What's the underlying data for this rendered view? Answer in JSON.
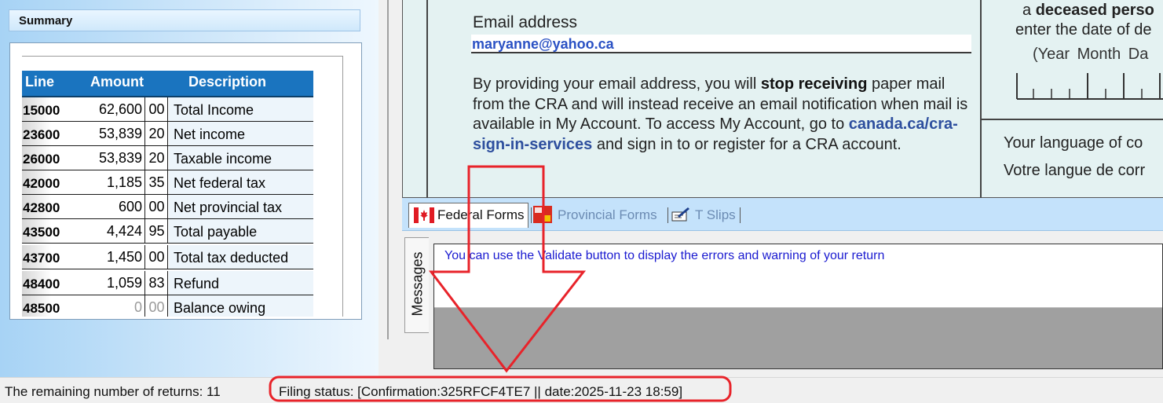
{
  "summary": {
    "title": "Summary",
    "columns": {
      "line": "Line",
      "amount": "Amount",
      "description": "Description"
    },
    "rows": [
      {
        "line": "15000",
        "amount": "62,600",
        "cents": "00",
        "description": "Total Income"
      },
      {
        "line": "23600",
        "amount": "53,839",
        "cents": "20",
        "description": "Net income"
      },
      {
        "line": "26000",
        "amount": "53,839",
        "cents": "20",
        "description": "Taxable income"
      },
      {
        "line": "42000",
        "amount": "1,185",
        "cents": "35",
        "description": "Net federal tax"
      },
      {
        "line": "42800",
        "amount": "600",
        "cents": "00",
        "description": "Net provincial tax"
      },
      {
        "line": "43500",
        "amount": "4,424",
        "cents": "95",
        "description": "Total payable"
      },
      {
        "line": "43700",
        "amount": "1,450",
        "cents": "00",
        "description": "Total tax deducted"
      },
      {
        "line": "48400",
        "amount": "1,059",
        "cents": "83",
        "description": "Refund"
      },
      {
        "line": "48500",
        "amount": "0",
        "cents": "00",
        "description": "Balance owing"
      }
    ]
  },
  "form": {
    "email_label": "Email address",
    "email_value": "maryanne@yahoo.ca",
    "para_part1": "By providing your email address, you will ",
    "para_bold": "stop receiving",
    "para_part2": " paper mail from the CRA and will instead receive an email notification when mail is available in My Account. To access My Account, go to ",
    "para_link": "canada.ca/cra-sign-in-services",
    "para_part3": " and sign in to or register for a CRA account.",
    "deceased_prefix": "a ",
    "deceased_bold": "deceased perso",
    "deceased_date": "enter the date of de",
    "date_labels": "(Year  Month  Da",
    "lang_en": "Your language of co",
    "lang_fr": "Votre langue de corr"
  },
  "tabs": {
    "federal": "Federal Forms",
    "provincial": "Provincial Forms",
    "tslips": "T Slips"
  },
  "messages": {
    "tab_label": "Messages",
    "text": "You can use the Validate button to display the errors and warning of your return"
  },
  "status": {
    "remaining": "The remaining number of returns: 11",
    "filing": "Filing status: [Confirmation:325RFCF4TE7 || date:2025-11-23 18:59]"
  },
  "colors": {
    "annotation": "#e8232a",
    "table_header": "#1a74bf",
    "link": "#2e4f9e"
  },
  "icons": {
    "federal": "canada-flag-icon",
    "provincial": "provincial-flag-icon",
    "tslips": "pen-document-icon"
  }
}
